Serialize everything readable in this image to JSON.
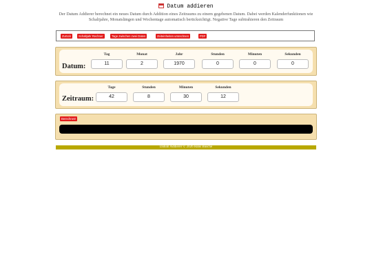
{
  "header": {
    "title": "Datum addieren",
    "intro": "Der Datum Addierer berechnet ein neues Datum durch Addition eines Zeitraums zu einem gegebenen Datum. Dabei werden Kalenderfunktionen wie Schaltjahre, Monatslängen und Wochentage automatisch berücksichtigt. Negative Tage subtrahieren den Zeitraum"
  },
  "toolbar": {
    "back": "Zurück",
    "leapyear": "Schaltjahr Rechner",
    "days_between": "Tage zwischen zwei Daten",
    "time_units": "Zeiteinheiten umrechnen",
    "pdf": "PDF"
  },
  "datum": {
    "label": "Datum:",
    "headers": [
      "Tag",
      "Monat",
      "Jahr",
      "Stunden",
      "Minuten",
      "Sekunden"
    ],
    "values": [
      "11",
      "2",
      "1970",
      "0",
      "0",
      "0"
    ]
  },
  "zeitraum": {
    "label": "Zeitraum:",
    "headers": [
      "Tage",
      "Stunden",
      "Minuten",
      "Sekunden"
    ],
    "values": [
      "42",
      "8",
      "30",
      "12"
    ]
  },
  "result": {
    "button": "Berechnen!",
    "value": ""
  },
  "footer": {
    "text": "Datum Addierer © 2026 Hans Busche"
  }
}
